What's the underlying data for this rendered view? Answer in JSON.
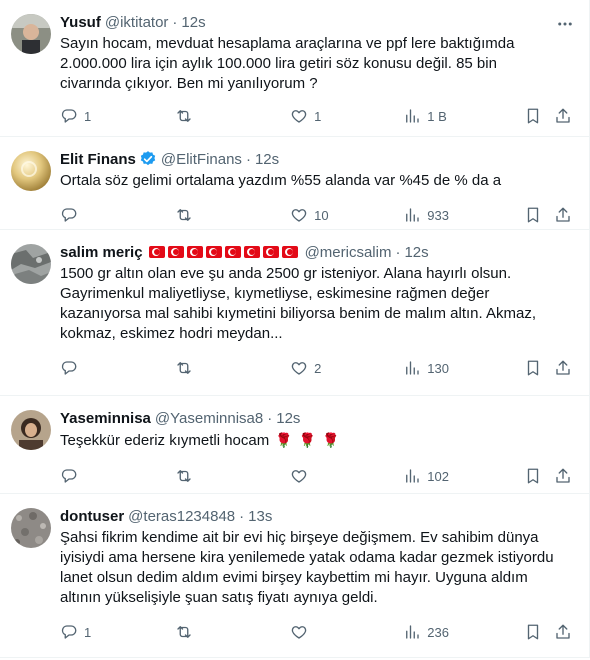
{
  "tweets": [
    {
      "name": "Yusuf",
      "handle": "@iktitator",
      "time": "12s",
      "text": "Sayın hocam, mevduat hesaplama araçlarına ve ppf lere baktığımda\n2.000.000 lira için aylık 100.000 lira getiri söz konusu değil. 85 bin\ncivarında çıkıyor. Ben mi yanılıyorum ?",
      "replies": "1",
      "retweets": "",
      "likes": "1",
      "views": "1 B"
    },
    {
      "name": "Elit Finans",
      "handle": "@ElitFinans",
      "time": "12s",
      "verified": true,
      "text": "Ortala söz gelimi  ortalama yazdım %55 alanda var %45 de % da a",
      "replies": "",
      "retweets": "",
      "likes": "10",
      "views": "933"
    },
    {
      "name": "salim meriç",
      "handle": "@mericsalim",
      "time": "12s",
      "flag_count": 8,
      "text": "1500 gr altın olan eve şu anda 2500 gr isteniyor. Alana hayırlı olsun.\nGayrimenkul maliyetliyse, kıymetliyse, eskimesine rağmen değer\nkazanıyorsa mal sahibi kıymetini biliyorsa benim de malım altın. Akmaz,\nkokmaz, eskimez hodri meydan...",
      "replies": "",
      "retweets": "",
      "likes": "2",
      "views": "130"
    },
    {
      "name": "Yaseminnisa",
      "handle": "@Yaseminnisa8",
      "time": "12s",
      "text": "Teşekkür  ederiz  kıymetli  hocam",
      "rose_emoji": "🌹",
      "rose_count": 3,
      "replies": "",
      "retweets": "",
      "likes": "",
      "views": "102"
    },
    {
      "name": "dontuser",
      "handle": "@teras1234848",
      "time": "13s",
      "text": "Şahsi fikrim kendime ait bir evi hiç birşeye değişmem. Ev sahibim dünya\niyisiydi ama hersene kira yenilemede yatak odama kadar gezmek istiyordu\nlanet olsun dedim aldım evimi birşey kaybettim mi hayır. Uyguna aldım\naltının yükselişiyle şuan satış fiyatı aynıya geldi.",
      "replies": "1",
      "retweets": "",
      "likes": "",
      "views": "236"
    }
  ],
  "icons": {
    "reply": "reply-icon",
    "retweet": "retweet-icon",
    "like": "heart-icon",
    "views": "views-icon",
    "bookmark": "bookmark-icon",
    "share": "share-icon",
    "more": "more-icon",
    "verified": "verified-badge-icon"
  },
  "colors": {
    "text": "#0f1419",
    "secondary": "#536471",
    "divider": "#eff3f4",
    "verified": "#1d9bf0",
    "flag": "#e30a17"
  }
}
